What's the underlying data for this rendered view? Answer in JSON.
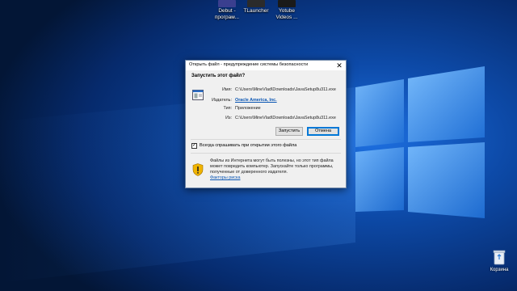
{
  "desktop": {
    "icons": [
      {
        "label_line1": "Debut -",
        "label_line2": "програм..."
      },
      {
        "label_line1": "TLauncher",
        "label_line2": ""
      },
      {
        "label_line1": "Yotube",
        "label_line2": "Videos ..."
      }
    ],
    "recycle_bin_label": "Корзина"
  },
  "dialog": {
    "title": "Открыть файл - предупреждение системы безопасности",
    "close_glyph": "✕",
    "question": "Запустить этот файл?",
    "name_label": "Имя:",
    "name_value": "C:\\Users\\MineVlad\\Downloads\\JavaSetup8u311.exe",
    "publisher_label": "Издатель:",
    "publisher_value": "Oracle America, Inc.",
    "type_label": "Тип:",
    "type_value": "Приложение",
    "from_label": "Из:",
    "from_value": "C:\\Users\\MineVlad\\Downloads\\JavaSetup8u311.exe",
    "run_button": "Запустить",
    "cancel_button": "Отмена",
    "always_ask_label": "Всегда спрашивать при открытии этого файла",
    "always_ask_checked": true,
    "checkbox_glyph": "✓",
    "warning_text": "Файлы из Интернета могут быть полезны, но этот тип файла может повредить компьютер. Запускайте только программы, полученные от доверенного издателя.",
    "risk_link": "Факторы риска"
  },
  "colors": {
    "wallpaper_dark": "#061a3f",
    "wallpaper_light": "#2f7fe0",
    "link": "#0b56b3",
    "accent": "#0078d7"
  }
}
